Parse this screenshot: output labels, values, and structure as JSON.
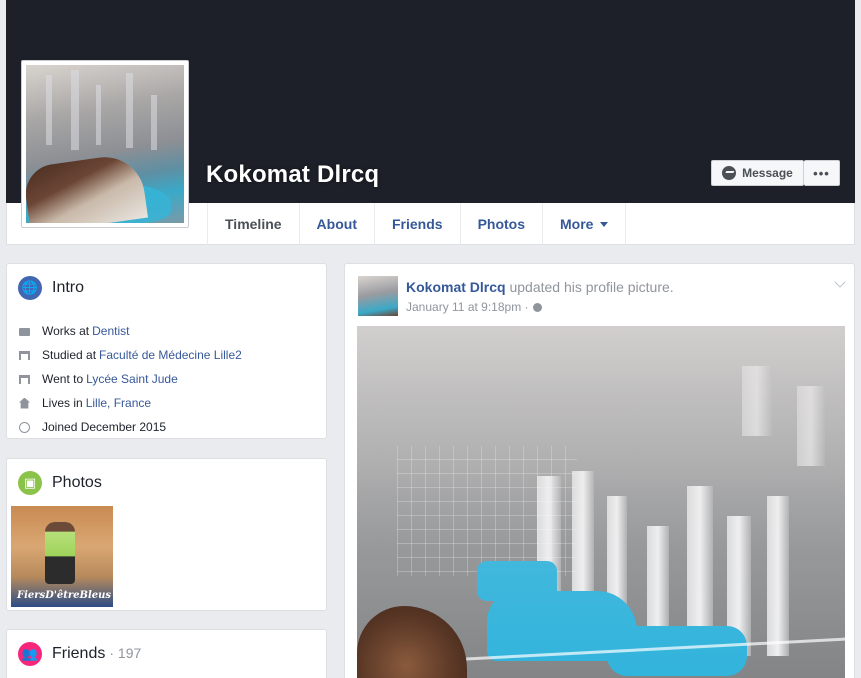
{
  "profile": {
    "name": "Kokomat Dlrcq"
  },
  "actions": {
    "message_label": "Message",
    "more_label": "•••"
  },
  "tabs": [
    {
      "label": "Timeline"
    },
    {
      "label": "About"
    },
    {
      "label": "Friends"
    },
    {
      "label": "Photos"
    },
    {
      "label": "More"
    }
  ],
  "intro": {
    "title": "Intro",
    "items": [
      {
        "prefix": "Works at",
        "link": "Dentist",
        "icon": "briefcase-icon"
      },
      {
        "prefix": "Studied at",
        "link": "Faculté de Médecine Lille2",
        "icon": "school-icon"
      },
      {
        "prefix": "Went to",
        "link": "Lycée Saint Jude",
        "icon": "school-icon"
      },
      {
        "prefix": "Lives in",
        "link": "Lille, France",
        "icon": "home-icon"
      },
      {
        "prefix": "Joined December 2015",
        "link": "",
        "icon": "clock-icon"
      }
    ]
  },
  "photos": {
    "title": "Photos",
    "thumb_watermark": "FiersD'êtreBleus"
  },
  "friends": {
    "title": "Friends",
    "count": "· 197"
  },
  "post": {
    "author": "Kokomat Dlrcq",
    "action": " updated his profile picture.",
    "timestamp": "January 11 at 9:18pm ·"
  },
  "colors": {
    "cover": "#1d2028",
    "link": "#365899",
    "intro_icon": "#4267b2",
    "photos_icon": "#8bc34a",
    "friends_icon": "#f7267b"
  }
}
